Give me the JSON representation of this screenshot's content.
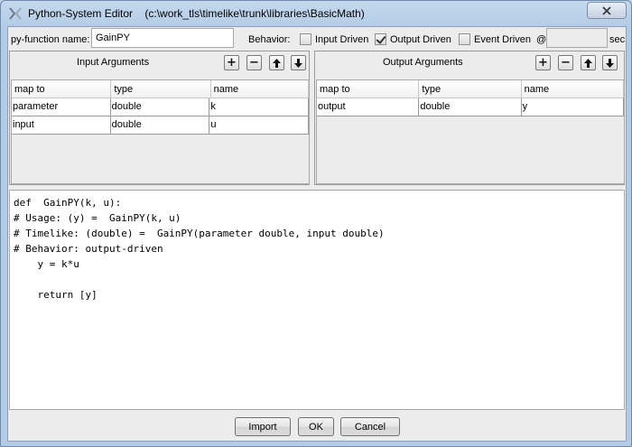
{
  "window": {
    "title": "Python-System Editor",
    "path": "(c:\\work_tls\\timelike\\trunk\\libraries\\BasicMath)"
  },
  "function": {
    "name_label": "py-function name:",
    "name_value": "GainPY"
  },
  "behavior": {
    "label": "Behavior:",
    "input_driven_label": "Input Driven",
    "input_driven_checked": false,
    "output_driven_label": "Output Driven",
    "output_driven_checked": true,
    "event_driven_label": "Event Driven",
    "event_driven_checked": false,
    "at_label": "@",
    "sec_label": "sec"
  },
  "input_args": {
    "title": "Input Arguments",
    "columns": [
      "map to",
      "type",
      "name"
    ],
    "rows": [
      [
        "parameter",
        "double",
        "k"
      ],
      [
        "input",
        "double",
        "u"
      ]
    ]
  },
  "output_args": {
    "title": "Output Arguments",
    "columns": [
      "map to",
      "type",
      "name"
    ],
    "rows": [
      [
        "output",
        "double",
        "y"
      ]
    ]
  },
  "code": "def  GainPY(k, u):\n# Usage: (y) =  GainPY(k, u)\n# Timelike: (double) =  GainPY(parameter double, input double)\n# Behavior: output-driven\n    y = k*u\n\n    return [y]",
  "buttons": {
    "import": "Import",
    "ok": "OK",
    "cancel": "Cancel",
    "add": "+",
    "remove": "−"
  }
}
